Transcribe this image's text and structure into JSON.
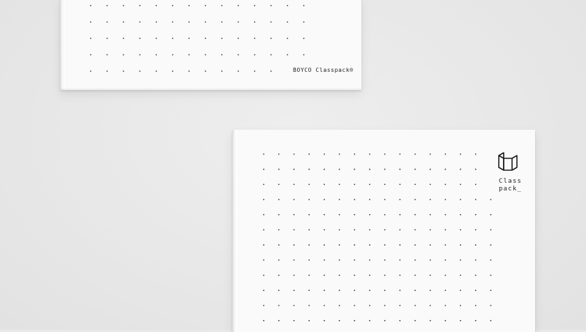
{
  "scene": {
    "background_color": "#e9e9e9",
    "cover_color": "#fafafa",
    "dot_color": "#333333"
  },
  "notebook_top": {
    "brand_text": "BOYCO Classpack®"
  },
  "notebook_bottom": {
    "logo_line1": "Class",
    "logo_line2": "pack_",
    "logo_icon": "isometric-box-icon"
  }
}
